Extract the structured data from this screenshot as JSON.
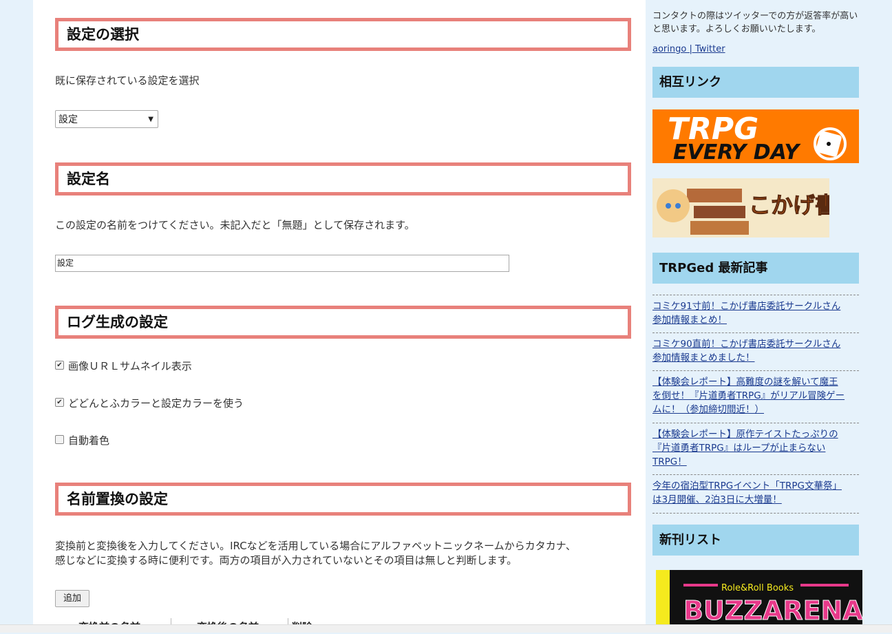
{
  "sections": {
    "select_title": "設定の選択",
    "select_desc": "既に保存されている設定を選択",
    "select_value": "設定",
    "name_title": "設定名",
    "name_desc": "この設定の名前をつけてください。未記入だと「無題」として保存されます。",
    "name_value": "設定",
    "log_title": "ログ生成の設定",
    "replace_title": "名前置換の設定",
    "replace_desc_1": "変換前と変換後を入力してください。IRCなどを活用している場合にアルファベットニックネームからカタカナ、",
    "replace_desc_2": "感じなどに変換する時に便利です。両方の項目が入力されていないとその項目は無しと判断します。",
    "add_button": "追加",
    "columns": [
      "変換前の名前",
      "変換後の名前",
      "削除"
    ]
  },
  "checkboxes": [
    {
      "label": "画像ＵＲＬサムネイル表示",
      "checked": true
    },
    {
      "label": "どどんとふカラーと設定カラーを使う",
      "checked": true
    },
    {
      "label": "自動着色",
      "checked": false
    }
  ],
  "sidebar": {
    "contact_text_1": "コンタクトの際はツイッターでの方が返答率が高い",
    "contact_text_2": "と思います。よろしくお願いいたします。",
    "twitter_link": "aoringo | Twitter",
    "mutual_links_title": "相互リンク",
    "banner1_line1": "TRPG",
    "banner1_line2": "EVERY DAY",
    "banner2_text": "こかげ書店",
    "latest_title": "TRPGed 最新記事",
    "articles": [
      {
        "line1": "コミケ91寸前！こかげ書店委託サークルさん",
        "line2": "参加情報まとめ！"
      },
      {
        "line1": "コミケ90直前！こかげ書店委託サークルさん",
        "line2": "参加情報まとめました！"
      },
      {
        "line1": "【体験会レポート】高難度の謎を解いて魔王",
        "line2": "を倒せ！『片道勇者TRPG』がリアル冒険ゲー",
        "line3": "ムに！（参加締切間近！）"
      },
      {
        "line1": "【体験会レポート】原作テイストたっぷりの",
        "line2": "『片道勇者TRPG』はループが止まらない",
        "line3": "TRPG！"
      },
      {
        "line1": "今年の宿泊型TRPGイベント「TRPG文華祭」",
        "line2": "は3月開催、2泊3日に大増量！"
      }
    ],
    "new_books_title": "新刊リスト",
    "book_publisher": "Role&Roll Books",
    "book_title": "BUZZARENA"
  },
  "colors": {
    "section_border": "#e8817b",
    "sidebar_heading": "#a0d6ee",
    "page_bg": "#e6f2fb"
  }
}
